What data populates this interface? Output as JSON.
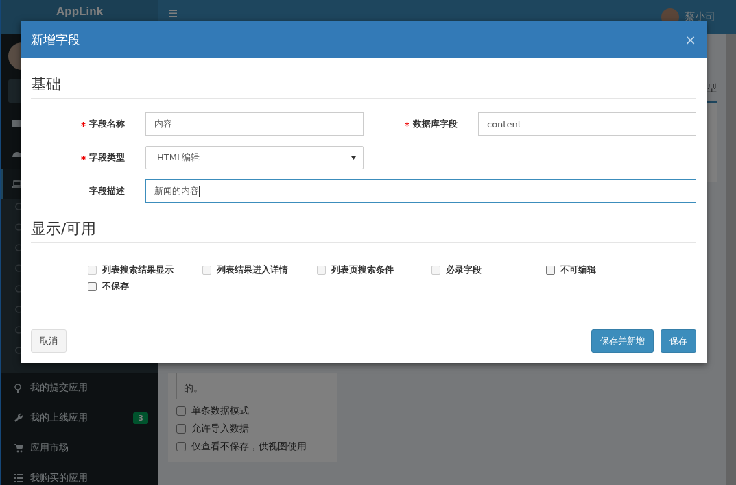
{
  "app": {
    "logo": "AppLink",
    "user_name": "蔡小司"
  },
  "sidebar": {
    "items": [
      {
        "label": "我的提交应用"
      },
      {
        "label": "我的上线应用",
        "badge": "3"
      },
      {
        "label": "应用市场"
      },
      {
        "label": "我购买的应用"
      }
    ]
  },
  "background": {
    "tab_fragment": "型",
    "textarea_value": "的。",
    "options": [
      {
        "label": "单条数据模式",
        "checked": false
      },
      {
        "label": "允许导入数据",
        "checked": false
      },
      {
        "label": "仅查看不保存，供视图使用",
        "checked": false
      }
    ]
  },
  "modal": {
    "title": "新增字段",
    "close": "×",
    "sections": [
      {
        "title": "基础",
        "fields": [
          {
            "label": "字段名称",
            "required": true,
            "kind": "text",
            "value": "内容",
            "wide": false
          },
          {
            "label": "数据库字段",
            "required": true,
            "kind": "text",
            "value": "content",
            "wide": false
          },
          {
            "label": "字段类型",
            "required": true,
            "kind": "select",
            "value": "HTML编辑",
            "wide": false
          },
          {
            "label": "字段描述",
            "required": false,
            "kind": "text",
            "value": "新闻的内容",
            "wide": true,
            "focused": true
          }
        ]
      },
      {
        "title": "显示/可用",
        "checkboxes": [
          {
            "label": "列表搜索结果显示",
            "checked": false,
            "disabled": true
          },
          {
            "label": "列表结果进入详情",
            "checked": false,
            "disabled": true
          },
          {
            "label": "列表页搜索条件",
            "checked": false,
            "disabled": true
          },
          {
            "label": "必录字段",
            "checked": false,
            "disabled": true
          },
          {
            "label": "不可编辑",
            "checked": false,
            "disabled": false
          },
          {
            "label": "不保存",
            "checked": false,
            "disabled": false
          }
        ]
      }
    ],
    "buttons": [
      {
        "label": "取消",
        "kind": "default"
      },
      {
        "label": "保存并新增",
        "kind": "primary"
      },
      {
        "label": "保存",
        "kind": "primary"
      }
    ]
  }
}
